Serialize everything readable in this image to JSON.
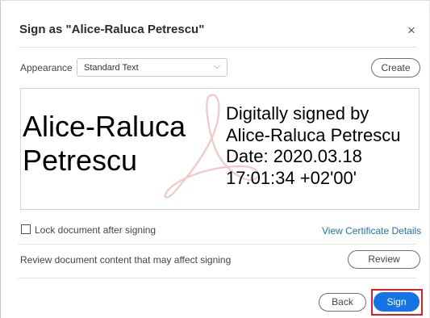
{
  "dialog": {
    "title": "Sign as \"Alice-Raluca Petrescu\"",
    "close_glyph": "×"
  },
  "appearance": {
    "label": "Appearance",
    "selected": "Standard Text",
    "create_label": "Create"
  },
  "preview": {
    "name_lines": [
      "Alice-Raluca",
      "Petrescu"
    ],
    "info_lines": [
      "Digitally signed by",
      "Alice-Raluca Petrescu",
      "Date: 2020.03.18",
      "17:01:34 +02'00'"
    ],
    "watermark_icon": "adobe-acrobat-icon"
  },
  "options": {
    "lock_label": "Lock document after signing",
    "lock_checked": false,
    "certificate_link": "View Certificate Details",
    "review_text": "Review document content that may affect signing",
    "review_label": "Review"
  },
  "footer": {
    "back_label": "Back",
    "sign_label": "Sign"
  },
  "colors": {
    "accent": "#1473e6",
    "link": "#1e6fb8",
    "highlight": "#e02020",
    "watermark": "#f3c7c7"
  }
}
